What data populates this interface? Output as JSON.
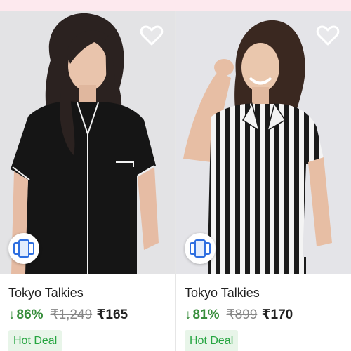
{
  "products": [
    {
      "brand": "Tokyo Talkies",
      "discount": "86%",
      "mrp": "₹1,249",
      "price": "₹165",
      "badge": "Hot Deal",
      "image_desc": "woman in black short-sleeve pyjama shirt with white piping"
    },
    {
      "brand": "Tokyo Talkies",
      "discount": "81%",
      "mrp": "₹899",
      "price": "₹170",
      "badge": "Hot Deal",
      "image_desc": "woman in black and white striped short-sleeve pyjama shirt"
    }
  ],
  "icons": {
    "discount_arrow": "↓",
    "wishlist": "heart-outline-icon",
    "similar": "similar-products-icon"
  },
  "colors": {
    "discount": "#388e3c",
    "deal_bg": "#e8f5e9",
    "deal_text": "#26a541",
    "top_strip": "#fde9ee"
  }
}
